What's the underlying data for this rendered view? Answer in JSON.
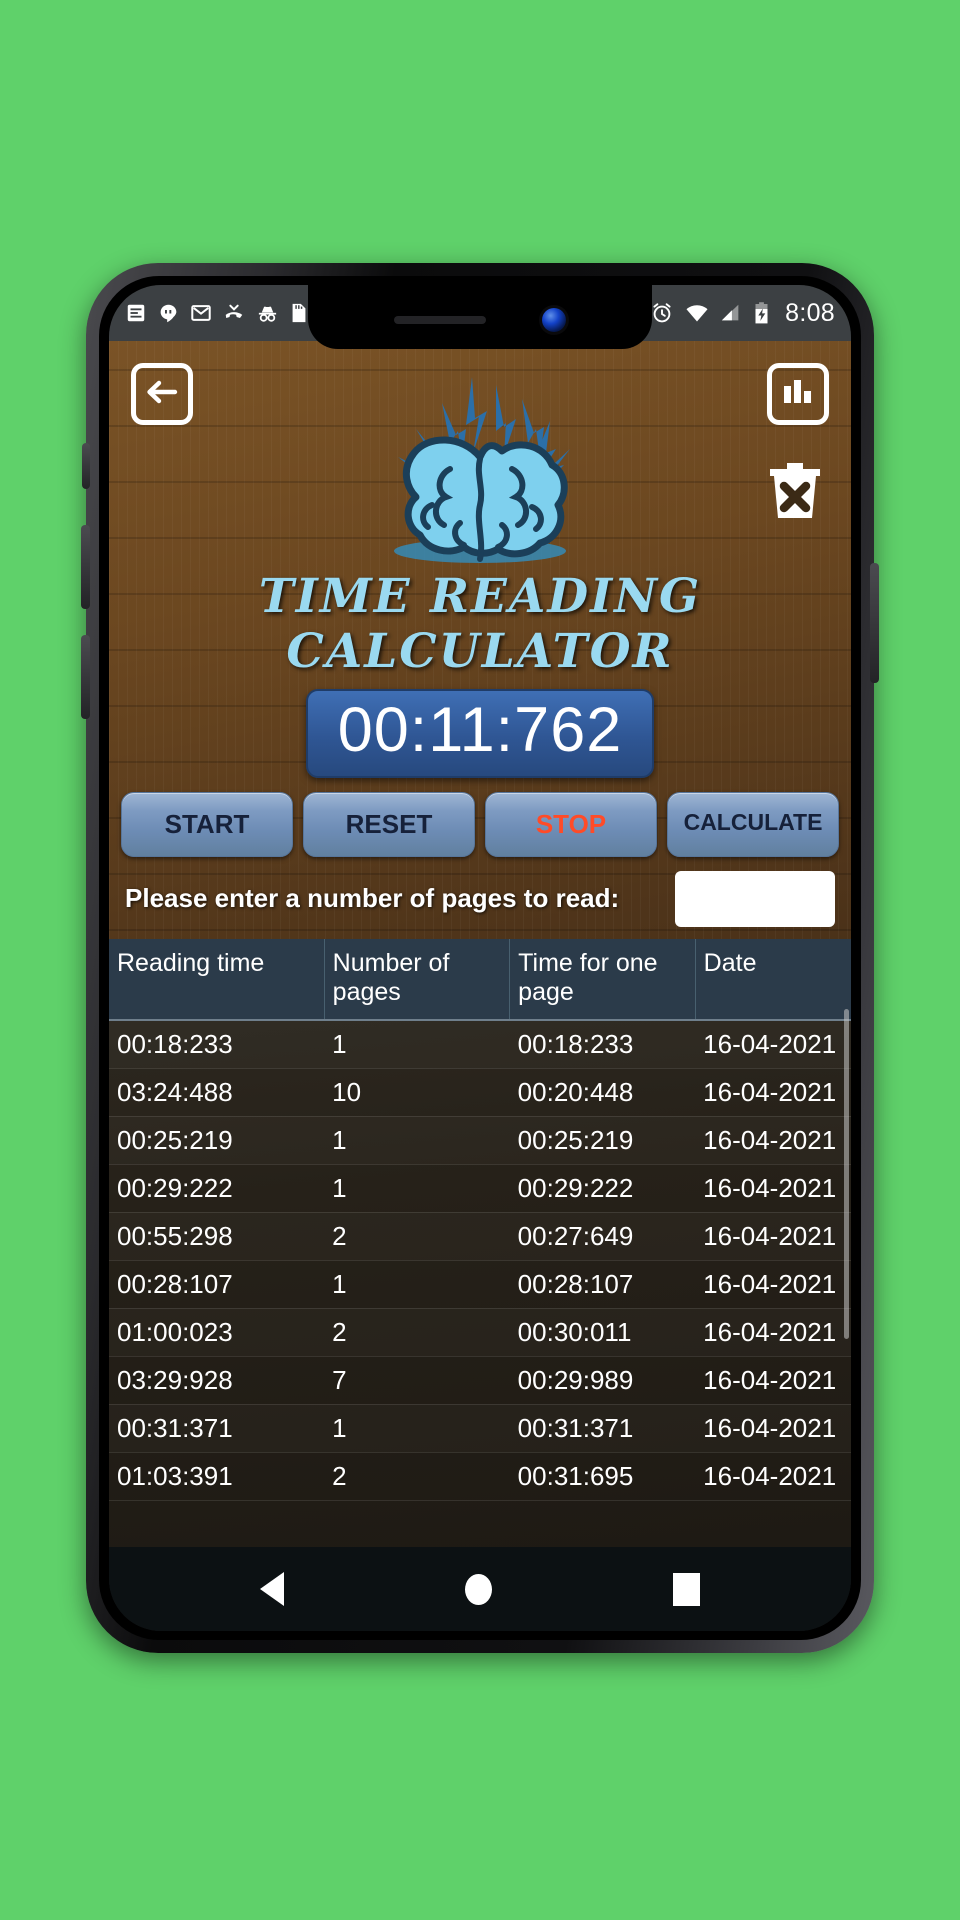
{
  "status_bar": {
    "left_icons": [
      "news-icon",
      "hangouts-icon",
      "gmail-icon",
      "missed-call-icon",
      "incognito-icon",
      "sd-card-icon"
    ],
    "right_icons": [
      "alarm-icon",
      "wifi-icon",
      "signal-icon",
      "battery-charging-icon"
    ],
    "time": "8:08"
  },
  "app": {
    "title": "TIME READING CALCULATOR",
    "timer": "00:11:762",
    "back_icon": "arrow-left-icon",
    "chart_icon": "bar-chart-icon",
    "delete_icon": "trash-delete-icon",
    "logo": "brain-icon",
    "accent_blue": "#9ad9f0",
    "timer_box_color": "#2f5694"
  },
  "controls": [
    {
      "label": "START",
      "name": "start-button",
      "style": "normal"
    },
    {
      "label": "RESET",
      "name": "reset-button",
      "style": "normal"
    },
    {
      "label": "STOP",
      "name": "stop-button",
      "style": "stop"
    },
    {
      "label": "CALCULATE",
      "name": "calculate-button",
      "style": "small"
    }
  ],
  "input_section": {
    "label": "Please enter a number of pages to read:",
    "value": "",
    "placeholder": ""
  },
  "table": {
    "headers": [
      "Reading time",
      "Number of pages",
      "Time for one page",
      "Date"
    ],
    "rows": [
      [
        "00:18:233",
        "1",
        "00:18:233",
        "16-04-2021"
      ],
      [
        "03:24:488",
        "10",
        "00:20:448",
        "16-04-2021"
      ],
      [
        "00:25:219",
        "1",
        "00:25:219",
        "16-04-2021"
      ],
      [
        "00:29:222",
        "1",
        "00:29:222",
        "16-04-2021"
      ],
      [
        "00:55:298",
        "2",
        "00:27:649",
        "16-04-2021"
      ],
      [
        "00:28:107",
        "1",
        "00:28:107",
        "16-04-2021"
      ],
      [
        "01:00:023",
        "2",
        "00:30:011",
        "16-04-2021"
      ],
      [
        "03:29:928",
        "7",
        "00:29:989",
        "16-04-2021"
      ],
      [
        "00:31:371",
        "1",
        "00:31:371",
        "16-04-2021"
      ],
      [
        "01:03:391",
        "2",
        "00:31:695",
        "16-04-2021"
      ]
    ]
  },
  "nav_bar": {
    "back": "nav-back-icon",
    "home": "nav-home-icon",
    "recents": "nav-recents-icon"
  }
}
